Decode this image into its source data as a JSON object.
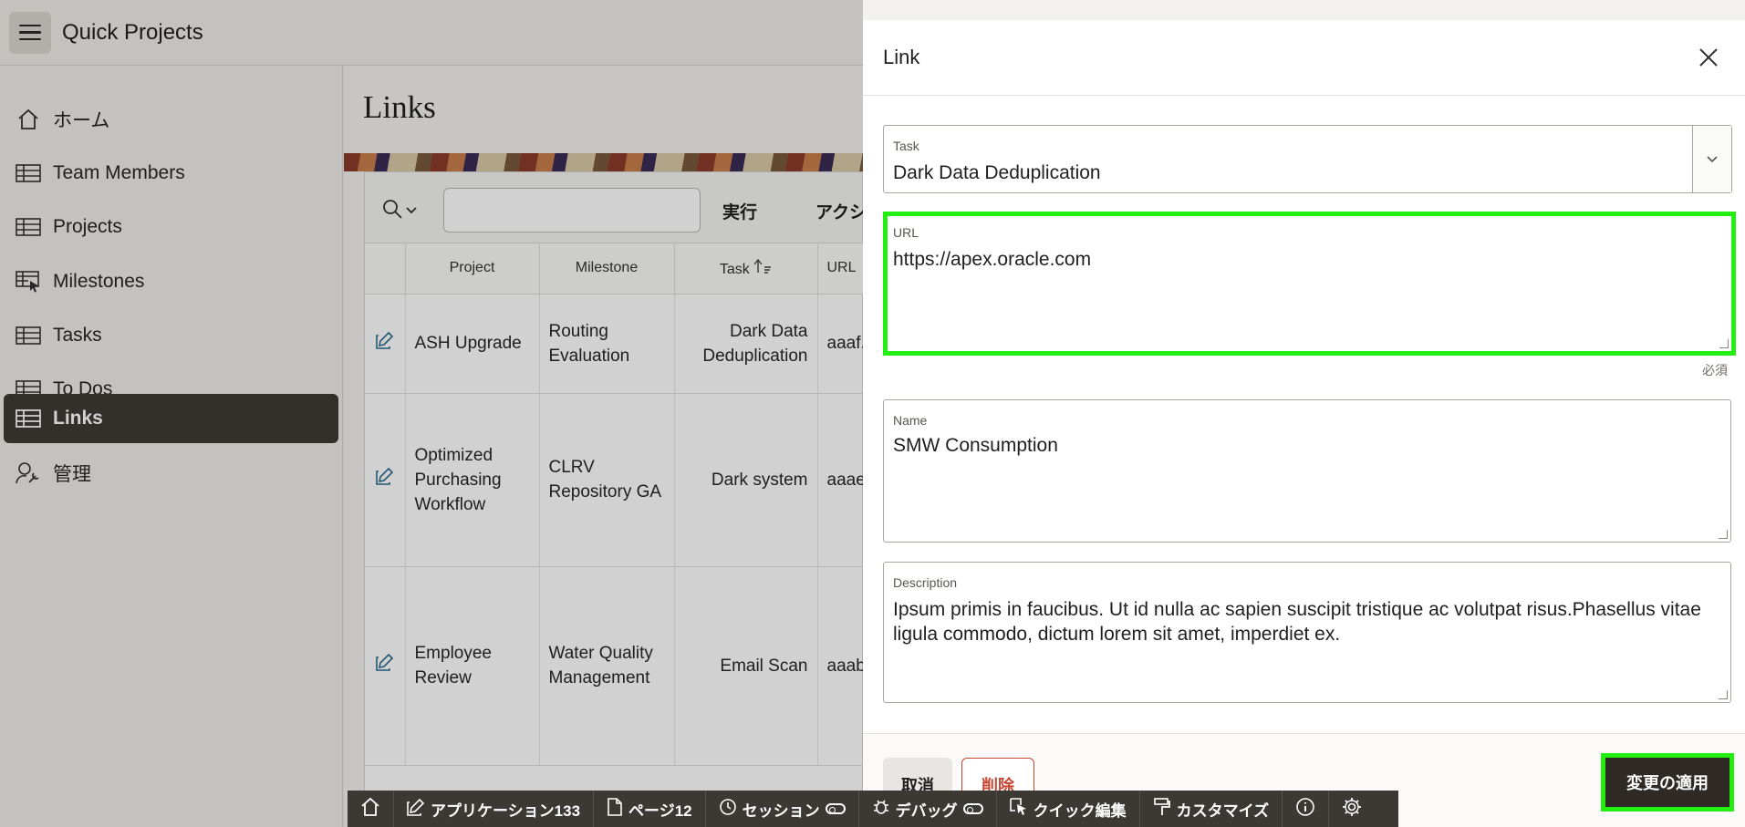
{
  "app": {
    "title": "Quick Projects"
  },
  "sidebar": {
    "items": [
      {
        "label": "ホーム",
        "icon": "home-icon",
        "active": false
      },
      {
        "label": "Team Members",
        "icon": "table-icon",
        "active": false
      },
      {
        "label": "Projects",
        "icon": "table-icon",
        "active": false
      },
      {
        "label": "Milestones",
        "icon": "table-pointer-icon",
        "active": false
      },
      {
        "label": "Tasks",
        "icon": "table-icon",
        "active": false
      },
      {
        "label": "To Dos",
        "icon": "table-icon",
        "active": false
      },
      {
        "label": "Links",
        "icon": "table-icon",
        "active": true
      },
      {
        "label": "管理",
        "icon": "user-wrench-icon",
        "active": false
      }
    ]
  },
  "page": {
    "title": "Links"
  },
  "report": {
    "toolbar": {
      "go_label": "実行",
      "actions_label": "アクシ"
    },
    "columns": [
      "Project",
      "Milestone",
      "Task",
      "URL"
    ],
    "rows": [
      {
        "project": "ASH Upgrade",
        "milestone": "Routing Evaluation",
        "task": "Dark Data Deduplication",
        "url": "aaaf."
      },
      {
        "project": "Optimized Purchasing Workflow",
        "milestone": "CLRV Repository GA",
        "task": "Dark system",
        "url": "aaae"
      },
      {
        "project": "Employee Review",
        "milestone": "Water Quality Management",
        "task": "Email Scan",
        "url": "aaab"
      }
    ]
  },
  "dialog": {
    "title": "Link",
    "task": {
      "label": "Task",
      "value": "Dark Data Deduplication"
    },
    "url": {
      "label": "URL",
      "value": "https://apex.oracle.com",
      "required": "必須"
    },
    "name": {
      "label": "Name",
      "value": "SMW Consumption"
    },
    "description": {
      "label": "Description",
      "value": "Ipsum primis in faucibus. Ut id nulla ac sapien suscipit tristique ac volutpat risus.Phasellus vitae ligula commodo, dictum lorem sit amet, imperdiet ex."
    },
    "buttons": {
      "cancel": "取消",
      "delete": "削除",
      "apply": "変更の適用"
    }
  },
  "devbar": {
    "application": "アプリケーション133",
    "page": "ページ12",
    "session": "セッション",
    "debug": "デバッグ",
    "quick_edit": "クイック編集",
    "customize": "カスタマイズ"
  },
  "colors": {
    "highlight": "#22ee11",
    "nav_active": "#3f3a35",
    "delete": "#c74634",
    "link": "#2b6c8e"
  }
}
